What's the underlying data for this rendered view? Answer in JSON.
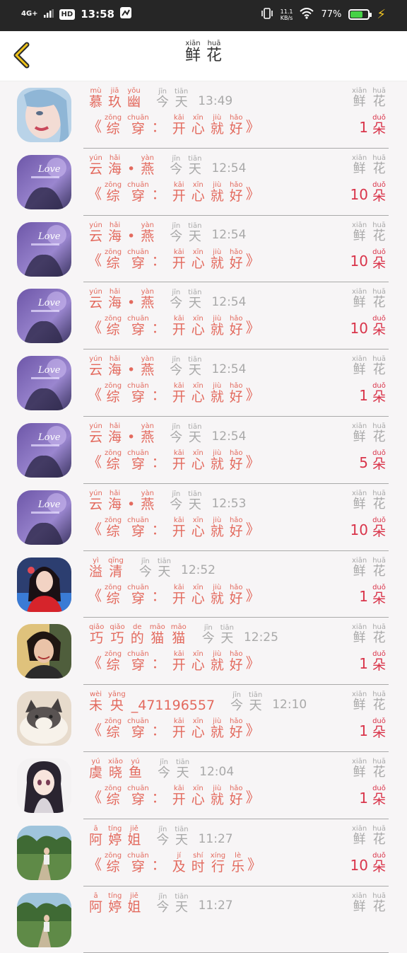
{
  "status": {
    "network": "4G+",
    "hd": "HD",
    "time": "13:58",
    "speed_top": "11.1",
    "speed_bottom": "KB/s",
    "battery": "77%",
    "battery_level": 0.77,
    "colors": {
      "bar": "#262626",
      "battery": "#46d246",
      "bolt": "#f3c623"
    }
  },
  "header": {
    "title": [
      {
        "py": "xiān",
        "ch": "鲜"
      },
      {
        "py": "huā",
        "ch": "花"
      }
    ]
  },
  "colors": {
    "name": "#e36a5e",
    "muted": "#a9a9a9",
    "count": "#d9344a"
  },
  "label": {
    "today": [
      {
        "py": "jīn",
        "ch": "今"
      },
      {
        "py": "tiān",
        "ch": "天"
      }
    ],
    "quote_open": "《",
    "quote_close": "》",
    "colon": "：",
    "flower": [
      {
        "py": "xiān",
        "ch": "鲜"
      },
      {
        "py": "huā",
        "ch": "花"
      }
    ],
    "unit": [
      {
        "py": "duǒ",
        "ch": "朵"
      }
    ]
  },
  "rows": [
    {
      "avatar": "girl-portrait-blue-avatar",
      "name": [
        {
          "py": "mù",
          "ch": "慕"
        },
        {
          "py": "jiā",
          "ch": "玖"
        },
        {
          "py": "yōu",
          "ch": "幽"
        }
      ],
      "time": "13:49",
      "book": [
        {
          "py": "zōng",
          "ch": "综"
        },
        {
          "py": "chuān",
          "ch": "穿"
        }
      ],
      "gift": [
        {
          "py": "kāi",
          "ch": "开"
        },
        {
          "py": "xīn",
          "ch": "心"
        },
        {
          "py": "jiù",
          "ch": "就"
        },
        {
          "py": "hǎo",
          "ch": "好"
        }
      ],
      "count": "1"
    },
    {
      "avatar": "love-purple-avatar",
      "name": [
        {
          "py": "yún",
          "ch": "云"
        },
        {
          "py": "hǎi",
          "ch": "海"
        },
        {
          "py": "",
          "ch": "•"
        },
        {
          "py": "yàn",
          "ch": "燕"
        }
      ],
      "time": "12:54",
      "book": [
        {
          "py": "zōng",
          "ch": "综"
        },
        {
          "py": "chuān",
          "ch": "穿"
        }
      ],
      "gift": [
        {
          "py": "kāi",
          "ch": "开"
        },
        {
          "py": "xīn",
          "ch": "心"
        },
        {
          "py": "jiù",
          "ch": "就"
        },
        {
          "py": "hǎo",
          "ch": "好"
        }
      ],
      "count": "10"
    },
    {
      "avatar": "love-purple-avatar",
      "name": [
        {
          "py": "yún",
          "ch": "云"
        },
        {
          "py": "hǎi",
          "ch": "海"
        },
        {
          "py": "",
          "ch": "•"
        },
        {
          "py": "yàn",
          "ch": "燕"
        }
      ],
      "time": "12:54",
      "book": [
        {
          "py": "zōng",
          "ch": "综"
        },
        {
          "py": "chuān",
          "ch": "穿"
        }
      ],
      "gift": [
        {
          "py": "kāi",
          "ch": "开"
        },
        {
          "py": "xīn",
          "ch": "心"
        },
        {
          "py": "jiù",
          "ch": "就"
        },
        {
          "py": "hǎo",
          "ch": "好"
        }
      ],
      "count": "10"
    },
    {
      "avatar": "love-purple-avatar",
      "name": [
        {
          "py": "yún",
          "ch": "云"
        },
        {
          "py": "hǎi",
          "ch": "海"
        },
        {
          "py": "",
          "ch": "•"
        },
        {
          "py": "yàn",
          "ch": "燕"
        }
      ],
      "time": "12:54",
      "book": [
        {
          "py": "zōng",
          "ch": "综"
        },
        {
          "py": "chuān",
          "ch": "穿"
        }
      ],
      "gift": [
        {
          "py": "kāi",
          "ch": "开"
        },
        {
          "py": "xīn",
          "ch": "心"
        },
        {
          "py": "jiù",
          "ch": "就"
        },
        {
          "py": "hǎo",
          "ch": "好"
        }
      ],
      "count": "10"
    },
    {
      "avatar": "love-purple-avatar",
      "name": [
        {
          "py": "yún",
          "ch": "云"
        },
        {
          "py": "hǎi",
          "ch": "海"
        },
        {
          "py": "",
          "ch": "•"
        },
        {
          "py": "yàn",
          "ch": "燕"
        }
      ],
      "time": "12:54",
      "book": [
        {
          "py": "zōng",
          "ch": "综"
        },
        {
          "py": "chuān",
          "ch": "穿"
        }
      ],
      "gift": [
        {
          "py": "kāi",
          "ch": "开"
        },
        {
          "py": "xīn",
          "ch": "心"
        },
        {
          "py": "jiù",
          "ch": "就"
        },
        {
          "py": "hǎo",
          "ch": "好"
        }
      ],
      "count": "1"
    },
    {
      "avatar": "love-purple-avatar",
      "name": [
        {
          "py": "yún",
          "ch": "云"
        },
        {
          "py": "hǎi",
          "ch": "海"
        },
        {
          "py": "",
          "ch": "•"
        },
        {
          "py": "yàn",
          "ch": "燕"
        }
      ],
      "time": "12:54",
      "book": [
        {
          "py": "zōng",
          "ch": "综"
        },
        {
          "py": "chuān",
          "ch": "穿"
        }
      ],
      "gift": [
        {
          "py": "kāi",
          "ch": "开"
        },
        {
          "py": "xīn",
          "ch": "心"
        },
        {
          "py": "jiù",
          "ch": "就"
        },
        {
          "py": "hǎo",
          "ch": "好"
        }
      ],
      "count": "5"
    },
    {
      "avatar": "love-purple-avatar",
      "name": [
        {
          "py": "yún",
          "ch": "云"
        },
        {
          "py": "hǎi",
          "ch": "海"
        },
        {
          "py": "",
          "ch": "•"
        },
        {
          "py": "yàn",
          "ch": "燕"
        }
      ],
      "time": "12:53",
      "book": [
        {
          "py": "zōng",
          "ch": "综"
        },
        {
          "py": "chuān",
          "ch": "穿"
        }
      ],
      "gift": [
        {
          "py": "kāi",
          "ch": "开"
        },
        {
          "py": "xīn",
          "ch": "心"
        },
        {
          "py": "jiù",
          "ch": "就"
        },
        {
          "py": "hǎo",
          "ch": "好"
        }
      ],
      "count": "10"
    },
    {
      "avatar": "girl-red-dress-avatar",
      "name": [
        {
          "py": "yì",
          "ch": "溢"
        },
        {
          "py": "qīng",
          "ch": "清"
        }
      ],
      "time": "12:52",
      "book": [
        {
          "py": "zōng",
          "ch": "综"
        },
        {
          "py": "chuān",
          "ch": "穿"
        }
      ],
      "gift": [
        {
          "py": "kāi",
          "ch": "开"
        },
        {
          "py": "xīn",
          "ch": "心"
        },
        {
          "py": "jiù",
          "ch": "就"
        },
        {
          "py": "hǎo",
          "ch": "好"
        }
      ],
      "count": "1"
    },
    {
      "avatar": "woman-selfie-avatar",
      "name": [
        {
          "py": "qiǎo",
          "ch": "巧"
        },
        {
          "py": "qiǎo",
          "ch": "巧"
        },
        {
          "py": "de",
          "ch": "的"
        },
        {
          "py": "māo",
          "ch": "猫"
        },
        {
          "py": "māo",
          "ch": "猫"
        }
      ],
      "time": "12:25",
      "book": [
        {
          "py": "zōng",
          "ch": "综"
        },
        {
          "py": "chuān",
          "ch": "穿"
        }
      ],
      "gift": [
        {
          "py": "kāi",
          "ch": "开"
        },
        {
          "py": "xīn",
          "ch": "心"
        },
        {
          "py": "jiù",
          "ch": "就"
        },
        {
          "py": "hǎo",
          "ch": "好"
        }
      ],
      "count": "1"
    },
    {
      "avatar": "cat-avatar",
      "name": [
        {
          "py": "wèi",
          "ch": "未"
        },
        {
          "py": "yāng",
          "ch": "央"
        },
        {
          "py": "",
          "ch": "_471196557"
        }
      ],
      "time": "12:10",
      "book": [
        {
          "py": "zōng",
          "ch": "综"
        },
        {
          "py": "chuān",
          "ch": "穿"
        }
      ],
      "gift": [
        {
          "py": "kāi",
          "ch": "开"
        },
        {
          "py": "xīn",
          "ch": "心"
        },
        {
          "py": "jiù",
          "ch": "就"
        },
        {
          "py": "hǎo",
          "ch": "好"
        }
      ],
      "count": "1"
    },
    {
      "avatar": "anime-girl-avatar",
      "name": [
        {
          "py": "yú",
          "ch": "虞"
        },
        {
          "py": "xiǎo",
          "ch": "晓"
        },
        {
          "py": "yú",
          "ch": "鱼"
        }
      ],
      "time": "12:04",
      "book": [
        {
          "py": "zōng",
          "ch": "综"
        },
        {
          "py": "chuān",
          "ch": "穿"
        }
      ],
      "gift": [
        {
          "py": "kāi",
          "ch": "开"
        },
        {
          "py": "xīn",
          "ch": "心"
        },
        {
          "py": "jiù",
          "ch": "就"
        },
        {
          "py": "hǎo",
          "ch": "好"
        }
      ],
      "count": "1"
    },
    {
      "avatar": "outdoor-person-avatar",
      "name": [
        {
          "py": "ā",
          "ch": "阿"
        },
        {
          "py": "tíng",
          "ch": "婷"
        },
        {
          "py": "jiě",
          "ch": "姐"
        }
      ],
      "time": "11:27",
      "book": [
        {
          "py": "zōng",
          "ch": "综"
        },
        {
          "py": "chuān",
          "ch": "穿"
        }
      ],
      "gift": [
        {
          "py": "jí",
          "ch": "及"
        },
        {
          "py": "shí",
          "ch": "时"
        },
        {
          "py": "xíng",
          "ch": "行"
        },
        {
          "py": "lè",
          "ch": "乐"
        }
      ],
      "count": "10"
    },
    {
      "avatar": "outdoor-person-avatar",
      "name": [
        {
          "py": "ā",
          "ch": "阿"
        },
        {
          "py": "tíng",
          "ch": "婷"
        },
        {
          "py": "jiě",
          "ch": "姐"
        }
      ],
      "time": "11:27",
      "book": [],
      "gift": [],
      "count": ""
    }
  ]
}
